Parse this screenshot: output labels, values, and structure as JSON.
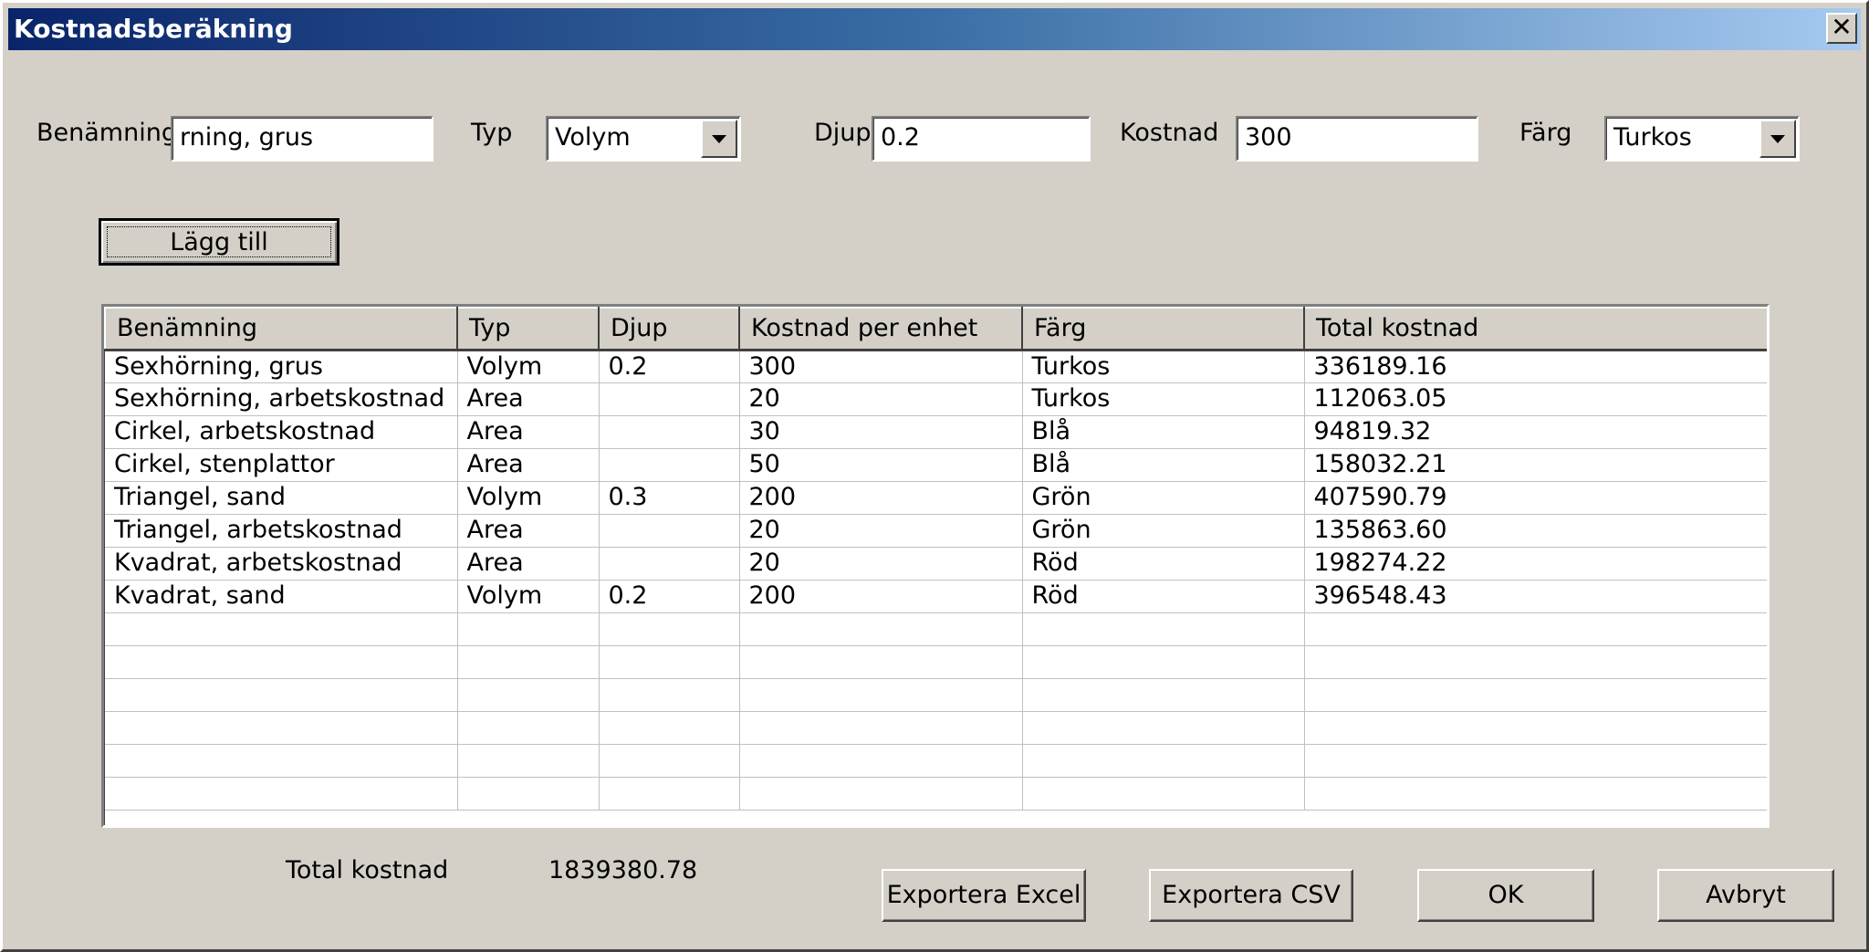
{
  "window": {
    "title": "Kostnadsberäkning",
    "close_glyph": "✕"
  },
  "form": {
    "name_label": "Benämning",
    "name_value": "rning, grus",
    "type_label": "Typ",
    "type_value": "Volym",
    "depth_label": "Djup",
    "depth_value": "0.2",
    "cost_label": "Kostnad",
    "cost_value": "300",
    "color_label": "Färg",
    "color_value": "Turkos",
    "add_button": "Lägg till"
  },
  "table": {
    "columns": [
      "Benämning",
      "Typ",
      "Djup",
      "Kostnad per enhet",
      "Färg",
      "Total kostnad"
    ],
    "rows": [
      [
        "Sexhörning, grus",
        "Volym",
        "0.2",
        "300",
        "Turkos",
        "336189.16"
      ],
      [
        "Sexhörning, arbetskostnad",
        "Area",
        "",
        "20",
        "Turkos",
        "112063.05"
      ],
      [
        "Cirkel, arbetskostnad",
        "Area",
        "",
        "30",
        "Blå",
        "94819.32"
      ],
      [
        "Cirkel, stenplattor",
        "Area",
        "",
        "50",
        "Blå",
        "158032.21"
      ],
      [
        "Triangel, sand",
        "Volym",
        "0.3",
        "200",
        "Grön",
        "407590.79"
      ],
      [
        "Triangel, arbetskostnad",
        "Area",
        "",
        "20",
        "Grön",
        "135863.60"
      ],
      [
        "Kvadrat, arbetskostnad",
        "Area",
        "",
        "20",
        "Röd",
        "198274.22"
      ],
      [
        "Kvadrat, sand",
        "Volym",
        "0.2",
        "200",
        "Röd",
        "396548.43"
      ]
    ],
    "empty_rows": 6
  },
  "footer": {
    "total_label": "Total kostnad",
    "total_value": "1839380.78",
    "export_excel": "Exportera Excel",
    "export_csv": "Exportera CSV",
    "ok": "OK",
    "cancel": "Avbryt"
  },
  "icons": {
    "close": "close-icon",
    "dropdown": "chevron-down-icon"
  },
  "colors": {
    "titlebar_start": "#0a246a",
    "titlebar_end": "#a6caf0",
    "window_bg": "#d4d0c8"
  }
}
